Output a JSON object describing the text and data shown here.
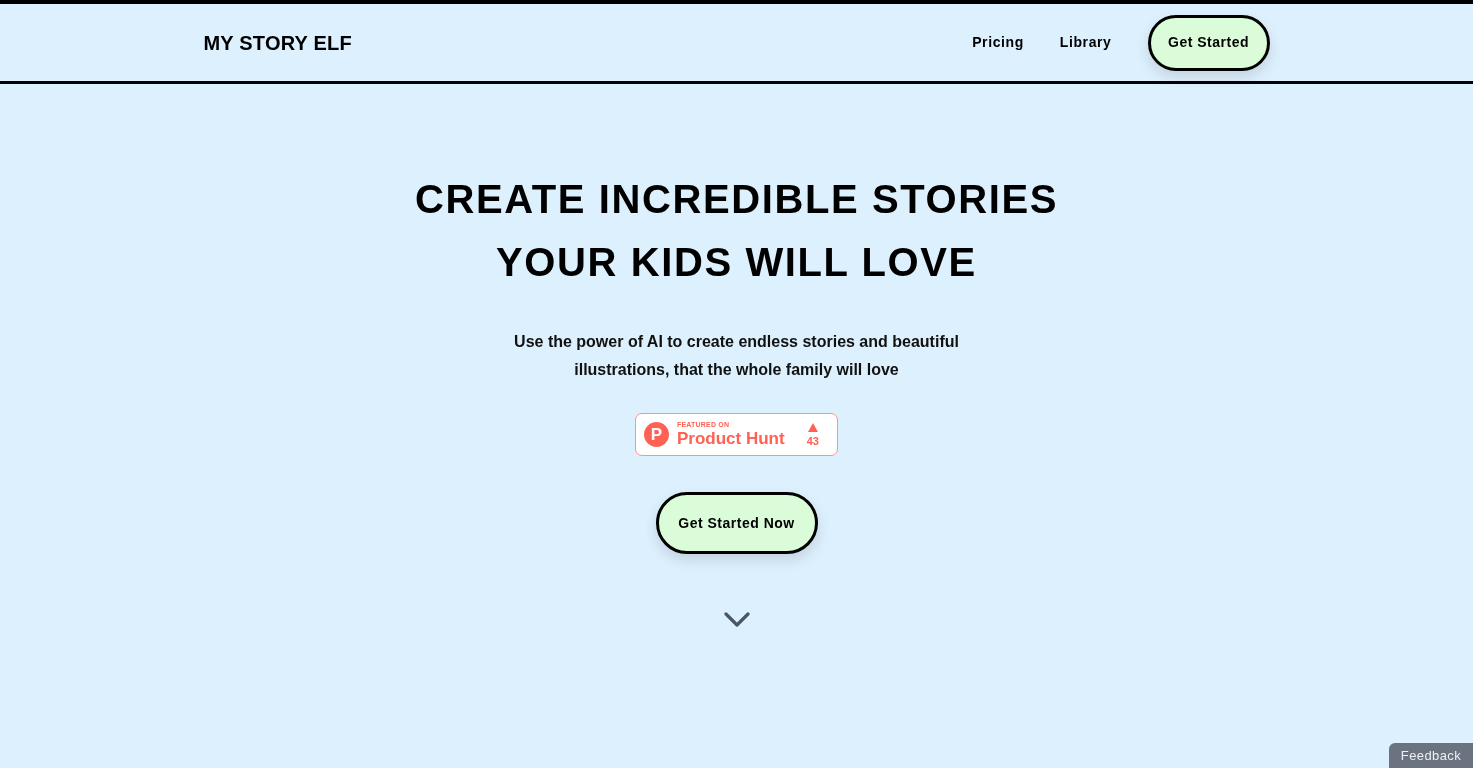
{
  "header": {
    "logo": "MY STORY ELF",
    "nav_links": [
      "Pricing",
      "Library"
    ],
    "cta_button": "Get Started"
  },
  "hero": {
    "title_lines": [
      "CREATE INCREDIBLE STORIES",
      "YOUR KIDS WILL LOVE"
    ],
    "subtitle": "Use the power of AI to create endless stories and beautiful illustrations, that the whole family will love",
    "badge": {
      "logo_letter": "P",
      "kicker": "FEATURED ON",
      "name": "Product Hunt",
      "votes": "43"
    },
    "cta_button": "Get Started Now"
  },
  "feedback_tab": "Feedback"
}
